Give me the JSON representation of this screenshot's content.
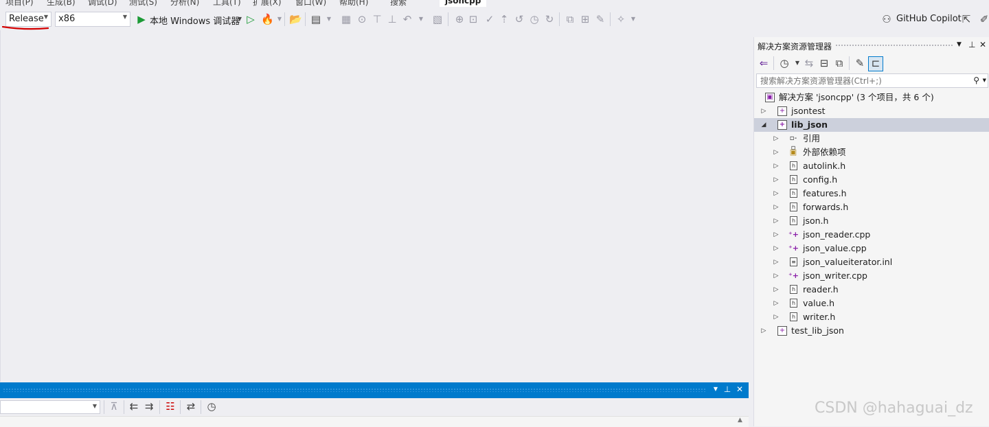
{
  "menu": {
    "items": [
      "项目(P)",
      "生成(B)",
      "调试(D)",
      "测试(S)",
      "分析(N)",
      "工具(T)",
      "扩展(X)",
      "窗口(W)",
      "帮助(H)",
      "搜索"
    ],
    "project_name": "jsoncpp"
  },
  "toolbar": {
    "configuration": "Release",
    "platform": "x86",
    "debugger_label": "本地 Windows 调试器",
    "copilot_label": "GitHub Copilot"
  },
  "solution_explorer": {
    "title": "解决方案资源管理器",
    "search_placeholder": "搜索解决方案资源管理器(Ctrl+;)",
    "solution_label": "解决方案 'jsoncpp' (3 个项目，共 6 个)",
    "projects": [
      {
        "name": "jsontest",
        "expanded": false
      },
      {
        "name": "lib_json",
        "expanded": true,
        "selected": true,
        "children": [
          {
            "name": "引用",
            "kind": "references"
          },
          {
            "name": "外部依赖项",
            "kind": "external"
          },
          {
            "name": "autolink.h",
            "kind": "header"
          },
          {
            "name": "config.h",
            "kind": "header"
          },
          {
            "name": "features.h",
            "kind": "header"
          },
          {
            "name": "forwards.h",
            "kind": "header"
          },
          {
            "name": "json.h",
            "kind": "header"
          },
          {
            "name": "json_reader.cpp",
            "kind": "cpp"
          },
          {
            "name": "json_value.cpp",
            "kind": "cpp"
          },
          {
            "name": "json_valueiterator.inl",
            "kind": "inl"
          },
          {
            "name": "json_writer.cpp",
            "kind": "cpp"
          },
          {
            "name": "reader.h",
            "kind": "header"
          },
          {
            "name": "value.h",
            "kind": "header"
          },
          {
            "name": "writer.h",
            "kind": "header"
          }
        ]
      },
      {
        "name": "test_lib_json",
        "expanded": false
      }
    ]
  },
  "watermark": "CSDN @hahaguai_dz",
  "colors": {
    "accent": "#007acc",
    "selection": "#ccd0dc",
    "annotation_red": "#d40000"
  }
}
